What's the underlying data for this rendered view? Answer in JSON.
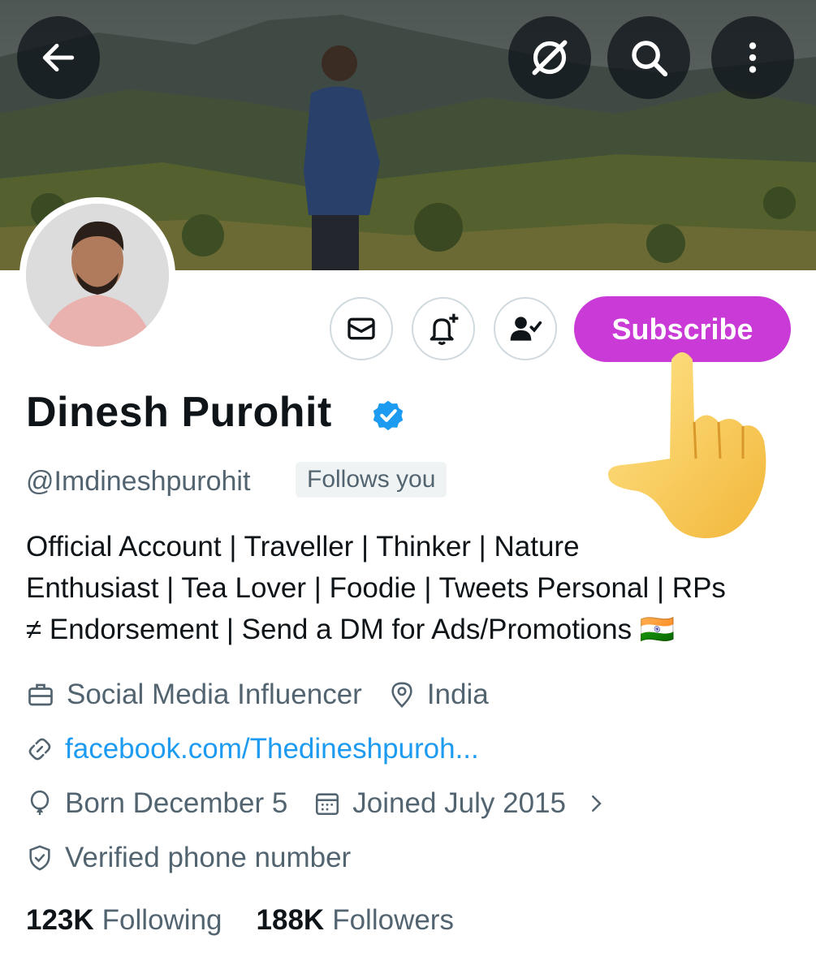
{
  "header": {
    "back_icon": "arrow-left-icon",
    "grok_icon": "grok-slash-icon",
    "search_icon": "search-icon",
    "more_icon": "more-vertical-icon"
  },
  "actions": {
    "message_icon": "envelope-icon",
    "notify_icon": "bell-plus-icon",
    "following_icon": "person-check-icon",
    "subscribe_label": "Subscribe",
    "subscribe_color": "#c93ad6"
  },
  "profile": {
    "name": "Dinesh Purohit",
    "handle": "@Imdineshpurohit",
    "follows_you": "Follows you",
    "bio_line1": "Official Account | Traveller | Thinker | Nature",
    "bio_line2": "Enthusiast | Tea Lover | Foodie | Tweets Personal | RPs",
    "bio_line3": "≠ Endorsement | Send a DM for Ads/Promotions 🇮🇳",
    "category": "Social Media Influencer",
    "location": "India",
    "website": "facebook.com/Thedineshpuroh...",
    "born": "Born December 5",
    "joined": "Joined July 2015",
    "verified_phone": "Verified phone number"
  },
  "stats": {
    "following_count": "123K",
    "following_label": "Following",
    "followers_count": "188K",
    "followers_label": "Followers"
  },
  "colors": {
    "accent_blue": "#1d9bf0",
    "muted_text": "#536471",
    "primary_text": "#0f1419"
  }
}
